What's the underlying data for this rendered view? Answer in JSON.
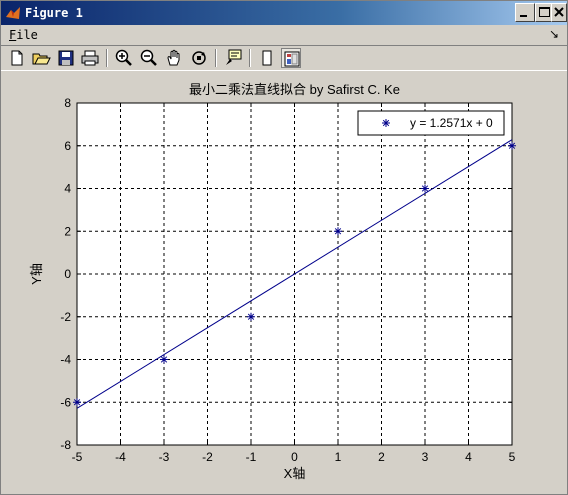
{
  "window": {
    "title": "Figure 1",
    "menu_file": "File",
    "menu_overflow_icon": "menu-overflow-arrow"
  },
  "toolbar": {
    "icons": [
      "new-figure-icon",
      "open-file-icon",
      "save-icon",
      "print-icon",
      "zoom-in-icon",
      "zoom-out-icon",
      "pan-hand-icon",
      "rotate-3d-icon",
      "data-cursor-icon",
      "hide-plot-tools-icon",
      "show-plot-tools-icon"
    ]
  },
  "chart_data": {
    "type": "line",
    "title": "最小二乘法直线拟合 by Safirst C. Ke",
    "xlabel": "X轴",
    "ylabel": "Y轴",
    "xlim": [
      -5,
      5
    ],
    "ylim": [
      -8,
      8
    ],
    "x_ticks": [
      "-5",
      "-4",
      "-3",
      "-2",
      "-1",
      "0",
      "1",
      "2",
      "3",
      "4",
      "5"
    ],
    "y_ticks": [
      "8",
      "6",
      "4",
      "2",
      "0",
      "-2",
      "-4",
      "-6",
      "-8"
    ],
    "grid": true,
    "grid_style": "dashed",
    "legend_position": "top-right",
    "series": [
      {
        "name": "y = 1.2571x + 0",
        "marker": "*",
        "color": "#00008b",
        "x": [
          -5,
          -3,
          -1,
          1,
          3,
          5
        ],
        "y": [
          -6,
          -4,
          -2,
          2,
          4,
          6
        ]
      },
      {
        "fit": {
          "slope": 1.2571,
          "intercept": 0
        },
        "x": [
          -5,
          5
        ],
        "color": "#00008b"
      }
    ]
  }
}
